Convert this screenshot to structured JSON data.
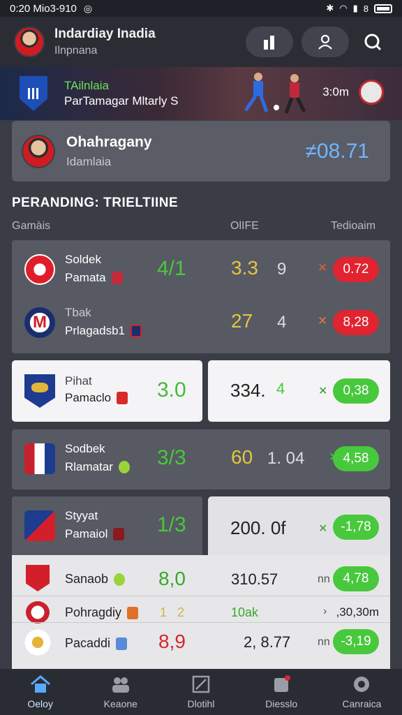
{
  "status_bar": {
    "time": "0:20 Mio3-910",
    "extra": "8"
  },
  "header": {
    "title": "Indardiay Inadia",
    "subtitle": "Ilnpnana"
  },
  "banner": {
    "tag": "TAilnlaia",
    "subtitle": "ParTamagar Mltarly S",
    "time": "3:0m"
  },
  "profile": {
    "name": "Ohahragany",
    "subtitle": "Idamlaia",
    "value": "≠08.71"
  },
  "section": {
    "title": "PERANDING: TRIELTIINE"
  },
  "columns": {
    "c1": "Gamàis",
    "c2": "OlIFE",
    "c3": "Tedioaim"
  },
  "rows": [
    {
      "name1": "Soldek",
      "name2": "Pamata",
      "score": "4/1",
      "odds": "3.3",
      "extra": "9",
      "trend": "✕",
      "pill": "0.72"
    },
    {
      "name1": "Tbak",
      "name2": "Prlagadsb1",
      "score": "",
      "odds": "27",
      "extra": "4",
      "trend": "✕",
      "pill": "8,28"
    },
    {
      "name1": "Pihat",
      "name2": "Pamaclo",
      "score": "3.0",
      "odds": "334.",
      "extra": "4",
      "trend": "✕",
      "pill": "0,38"
    },
    {
      "name1": "Sodbek",
      "name2": "Rlamatar",
      "score": "3/3",
      "odds": "60",
      "extra": "1. 04",
      "trend": "✕",
      "pill": "4,58"
    },
    {
      "name1": "Styyat",
      "name2": "Pamaiol",
      "score": "1/3",
      "odds": "200. 0f",
      "extra": "",
      "trend": "✕",
      "pill": "-1,78"
    }
  ],
  "list": [
    {
      "name": "Sanaob",
      "score": "8,0",
      "odds": "310.57",
      "tag": "nn",
      "pill": "4,78"
    },
    {
      "name": "Pohragdiy",
      "score": "1   2",
      "odds": "10ak",
      "tag": "›",
      "pill": ",30,30m"
    },
    {
      "name": "Pacaddi",
      "score": "8,9",
      "odds": "2, 8.77",
      "tag": "nn",
      "pill": "-3,19"
    }
  ],
  "nav": [
    {
      "label": "Oeloy",
      "icon": "home-icon",
      "active": true
    },
    {
      "label": "Keaone",
      "icon": "teams-icon",
      "active": false
    },
    {
      "label": "Dlotihl",
      "icon": "stats-icon",
      "active": false
    },
    {
      "label": "Diesslo",
      "icon": "notifications-icon",
      "active": false
    },
    {
      "label": "Canraica",
      "icon": "cart-icon",
      "active": false
    }
  ],
  "colors": {
    "accent_green": "#48c83c",
    "accent_red": "#e02430",
    "accent_blue": "#6fb6ff",
    "score_yellow": "#e2c640"
  }
}
